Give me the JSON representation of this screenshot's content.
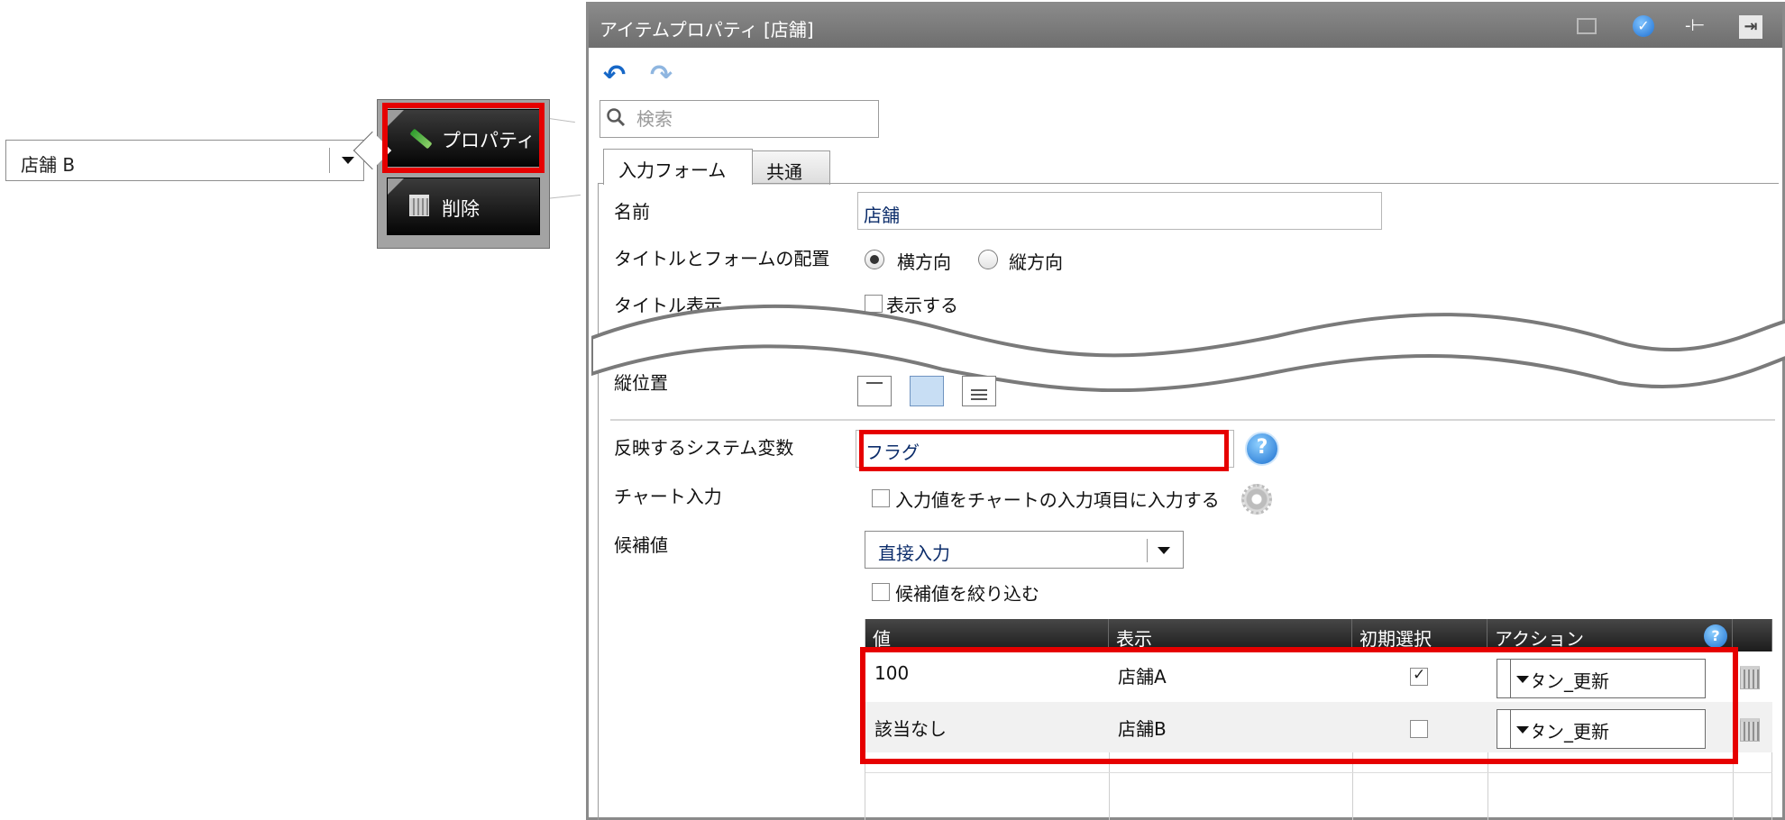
{
  "left_select": {
    "value": "店舗 B"
  },
  "context_menu": {
    "property_label": "プロパティ",
    "delete_label": "削除"
  },
  "window": {
    "title": "アイテムプロパティ [店舗]",
    "search_placeholder": "検索",
    "tabs": [
      {
        "label": "入力フォーム",
        "active": true
      },
      {
        "label": "共通",
        "active": false
      }
    ],
    "form": {
      "name_label": "名前",
      "name_value": "店舗",
      "layout_label": "タイトルとフォームの配置",
      "layout_options": [
        "横方向",
        "縦方向"
      ],
      "layout_selected": "横方向",
      "title_display_label": "タイトル表示",
      "title_display_option": "表示する",
      "vertical_position_label": "縦位置",
      "vertical_position_selected": "中央",
      "sysvar_label": "反映するシステム変数",
      "sysvar_value": "フラグ",
      "chart_input_label": "チャート入力",
      "chart_input_option": "入力値をチャートの入力項目に入力する",
      "candidates_label": "候補値",
      "candidates_mode": "直接入力",
      "filter_candidates_option": "候補値を絞り込む"
    },
    "grid": {
      "columns": [
        "値",
        "表示",
        "初期選択",
        "アクション"
      ],
      "rows": [
        {
          "value": "100",
          "display": "店舗A",
          "initial": true,
          "action": "ボタン_更新"
        },
        {
          "value": "該当なし",
          "display": "店舗B",
          "initial": false,
          "action": "ボタン_更新"
        }
      ]
    }
  },
  "colors": {
    "highlight": "#e60000",
    "titlebar": "#7a7a7a",
    "value_text": "#0c2d6b",
    "accent_blue": "#1b6fcf"
  },
  "icons": [
    "pencil-icon",
    "trash-icon",
    "maximize-icon",
    "check-icon",
    "pin-icon",
    "exit-icon",
    "undo-icon",
    "redo-icon",
    "search-icon",
    "help-icon",
    "gear-icon",
    "chevron-down-icon"
  ]
}
